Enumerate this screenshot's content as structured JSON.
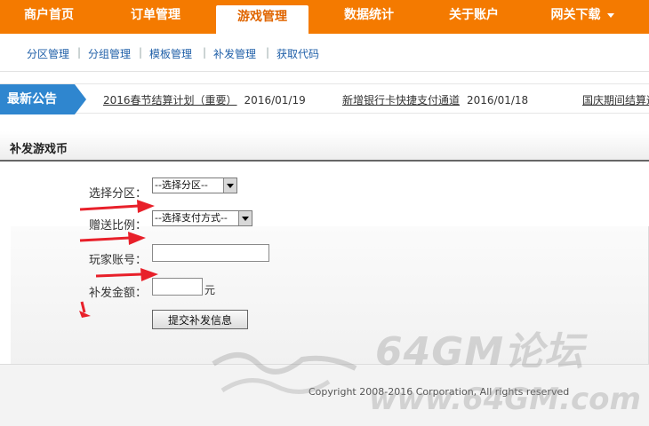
{
  "topnav": {
    "items": [
      "商户首页",
      "订单管理",
      "游戏管理",
      "数据统计",
      "关于账户",
      "网关下载"
    ],
    "active_index": 2
  },
  "subnav": {
    "links": [
      "分区管理",
      "分组管理",
      "模板管理",
      "补发管理",
      "获取代码"
    ],
    "separator": "|"
  },
  "notice": {
    "badge": "最新公告",
    "news": [
      {
        "title": "2016春节结算计划（重要）",
        "date": "2016/01/19"
      },
      {
        "title": "新增银行卡快捷支付通道",
        "date": "2016/01/18"
      },
      {
        "title": "国庆期间结算通"
      }
    ]
  },
  "section": {
    "title": "补发游戏币"
  },
  "form": {
    "zone_label": "选择分区：",
    "zone_value": "--选择分区--",
    "ratio_label": "赠送比例：",
    "ratio_value": "--选择支付方式--",
    "account_label": "玩家账号：",
    "account_value": "",
    "amount_label": "补发金额：",
    "amount_value": "",
    "amount_unit": "元",
    "submit_label": "提交补发信息"
  },
  "footer": {
    "copyright": "Copyright 2008-2016 Corporation, All rights reserved"
  },
  "watermark": {
    "site": "64GM论坛",
    "url": "www.64GM.com"
  },
  "colors": {
    "nav_orange": "#f47a00",
    "badge_blue": "#2f86cf",
    "link_blue": "#1f5fa8",
    "annotation_red": "#e8202a"
  }
}
